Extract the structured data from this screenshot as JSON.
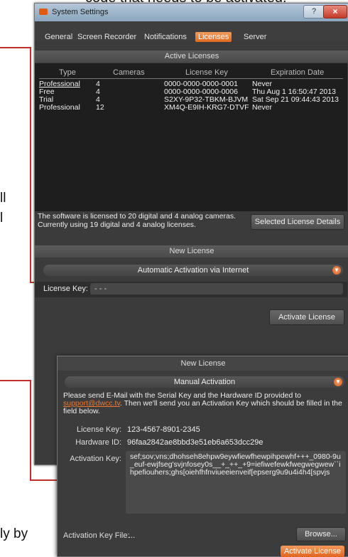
{
  "document": {
    "top_text": "code that needs to be activated.",
    "left_line1": "ll",
    "left_line2": "l",
    "bottom_text": "ly by"
  },
  "window": {
    "title": "System Settings",
    "help_label": "?",
    "close_label": "×"
  },
  "tabs": [
    {
      "label": "General"
    },
    {
      "label": "Screen Recorder"
    },
    {
      "label": "Notifications"
    },
    {
      "label": "Licenses"
    },
    {
      "label": "Server"
    }
  ],
  "active_licenses": {
    "header": "Active Licenses",
    "columns": [
      "Type",
      "Cameras",
      "License Key",
      "Expiration Date"
    ],
    "rows": [
      {
        "type": "Professional",
        "cameras": "4",
        "key": "0000-0000-0000-0001",
        "expiration": "Never"
      },
      {
        "type": "Free",
        "cameras": "4",
        "key": "0000-0000-0000-0006",
        "expiration": "Thu Aug 1 16:50:47 2013"
      },
      {
        "type": "Trial",
        "cameras": "4",
        "key": "S2XY-9P32-TBKM-BJVM",
        "expiration": "Sat Sep 21 09:44:43 2013"
      },
      {
        "type": "Professional",
        "cameras": "12",
        "key": "XM4Q-E9IH-KRG7-DTVF",
        "expiration": "Never"
      }
    ],
    "summary_line1": "The software is licensed to 20 digital and 4 analog cameras.",
    "summary_line2": "Currently using 19 digital and 4 analog licenses.",
    "details_button": "Selected License Details"
  },
  "new_license": {
    "header": "New License",
    "method": "Automatic Activation via Internet",
    "license_key_label": "License Key:",
    "license_key_value": "-   -   -",
    "activate_button": "Activate License"
  },
  "manual_panel": {
    "header": "New License",
    "method": "Manual Activation",
    "instructions_pre": "Please send E-Mail with the Serial Key and the Hardware ID provided to",
    "email": "support@dwcc.tv",
    "instructions_post": ". Then we'll send you an Activation Key which should be filled in the field below.",
    "license_key_label": "License Key:",
    "license_key_value": "123-4567-8901-2345",
    "hardware_id_label": "Hardware ID:",
    "hardware_id_value": "96faa2842ae8bbd3e51eb6a653dcc29e",
    "activation_key_label": "Activation Key:",
    "activation_key_value": "sef;sov;vns;dhohseh8ehpw9eywfiewfhewpihpewhf+++_0980-9u_euf-ewjfseg'svjnfosey0s__+_++_+9=iefiwefewkfwegwegwew``ihpefiouhers;ghs[oiehfhfnviueeienveif[epserg9u9u4i4h4[spvjs",
    "file_label": "Activation Key File:",
    "file_value": "...",
    "browse_button": "Browse...",
    "activate_button": "Activate License"
  },
  "colors": {
    "accent": "#e06a1f",
    "callout": "#c0302a"
  }
}
